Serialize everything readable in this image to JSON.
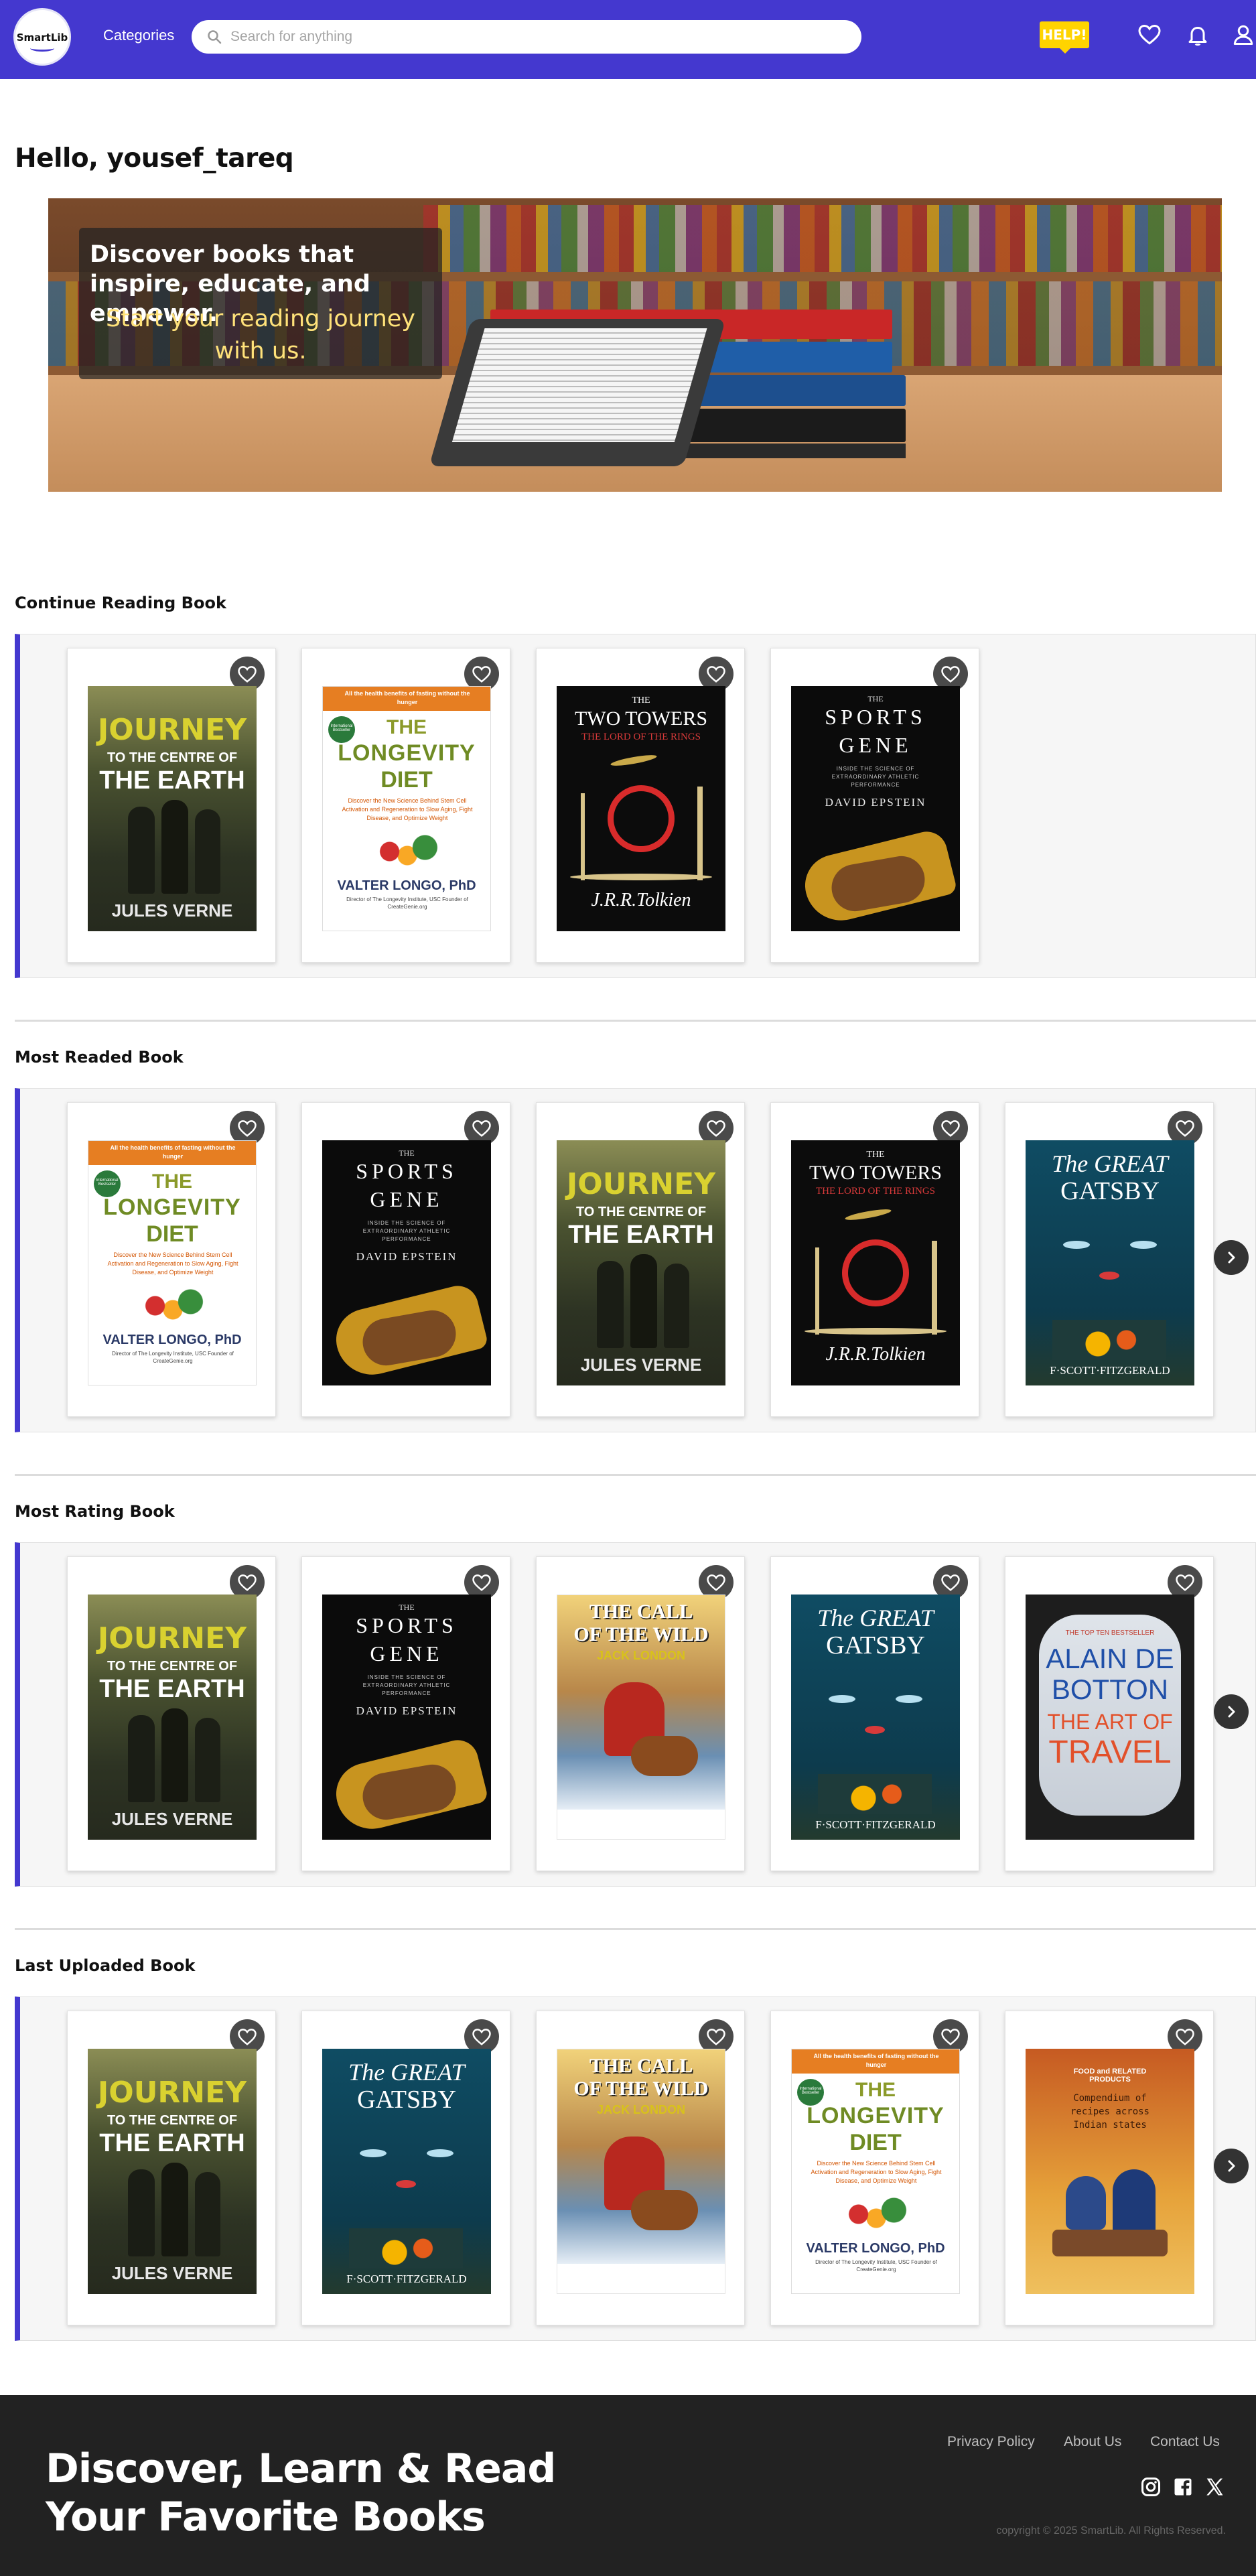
{
  "header": {
    "logo_text": "SmartLib",
    "categories_label": "Categories",
    "search_placeholder": "Search for anything",
    "help_label": "HELP!"
  },
  "greeting": "Hello, yousef_tareq",
  "hero": {
    "title": "Discover books that inspire, educate, and empower.",
    "subtitle": "Start your reading journey with us."
  },
  "sections": [
    {
      "title": "Continue Reading Book",
      "has_next": false,
      "books": [
        "journey",
        "longevity",
        "towers",
        "sports"
      ]
    },
    {
      "title": "Most Readed Book",
      "has_next": true,
      "books": [
        "longevity",
        "sports",
        "journey",
        "towers",
        "gatsby"
      ]
    },
    {
      "title": "Most Rating Book",
      "has_next": true,
      "books": [
        "journey",
        "sports",
        "wild",
        "gatsby",
        "travel"
      ]
    },
    {
      "title": "Last Uploaded Book",
      "has_next": true,
      "books": [
        "journey",
        "gatsby",
        "wild",
        "longevity",
        "food"
      ]
    }
  ],
  "covers": {
    "journey": {
      "l1": "JOURNEY",
      "l2": "TO THE CENTRE OF",
      "l3": "THE EARTH",
      "author": "JULES VERNE"
    },
    "longevity": {
      "band": "All the health benefits of fasting without the hunger",
      "seal": "International Bestseller",
      "l1": "THE",
      "l2": "LONGEVITY",
      "l3": "DIET",
      "blurb": "Discover the New Science Behind Stem Cell Activation and Regeneration to Slow Aging, Fight Disease, and Optimize Weight",
      "author": "VALTER LONGO, PhD",
      "credit": "Director of The Longevity Institute, USC Founder of CreateGenie.org"
    },
    "towers": {
      "l0": "THE",
      "l1": "TWO TOWERS",
      "l2": "THE LORD OF THE RINGS",
      "author": "J.R.R.Tolkien"
    },
    "sports": {
      "l0": "THE",
      "l1": "SPORTS",
      "l2": "GENE",
      "l3": "INSIDE THE SCIENCE OF EXTRAORDINARY ATHLETIC PERFORMANCE",
      "author": "DAVID EPSTEIN"
    },
    "gatsby": {
      "l1": "The GREAT",
      "l2": "GATSBY",
      "author": "F·SCOTT·FITZGERALD"
    },
    "wild": {
      "l1": "THE CALL",
      "l2": "OF THE WILD",
      "author": "JACK LONDON"
    },
    "travel": {
      "l0": "THE TOP TEN BESTSELLER",
      "l1": "ALAIN DE",
      "l2": "BOTTON",
      "l3": "THE ART OF",
      "l4": "TRAVEL"
    },
    "food": {
      "l1": "FOOD and RELATED PRODUCTS",
      "l2": "Compendium of recipes across Indian states"
    }
  },
  "footer": {
    "tagline": "Discover, Learn & Read Your Favorite Books",
    "links": [
      "Privacy Policy",
      "About Us",
      "Contact Us"
    ],
    "copyright": "copyright © 2025 SmartLib. All Rights Reserved."
  },
  "colors": {
    "brand": "#4438cf",
    "help": "#ffd400",
    "footer": "#222222"
  }
}
